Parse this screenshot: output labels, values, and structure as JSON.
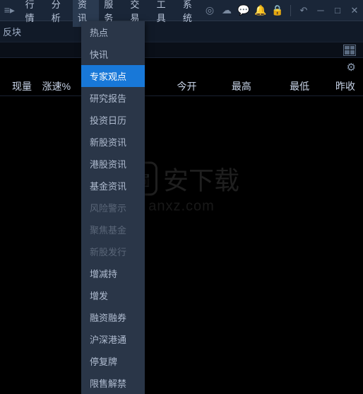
{
  "menubar": {
    "items": [
      "行情",
      "分析",
      "资讯",
      "服务",
      "交易",
      "工具",
      "系统"
    ],
    "activeIndex": 2
  },
  "subbar": {
    "label": "反块"
  },
  "columns": [
    "现量",
    "涨速%",
    "今开",
    "最高",
    "最低",
    "昨收"
  ],
  "dropdown": {
    "items": [
      {
        "label": "热点",
        "disabled": false
      },
      {
        "label": "快讯",
        "disabled": false
      },
      {
        "label": "专家观点",
        "disabled": false,
        "highlight": true
      },
      {
        "label": "研究报告",
        "disabled": false
      },
      {
        "label": "投资日历",
        "disabled": false
      },
      {
        "label": "新股资讯",
        "disabled": false
      },
      {
        "label": "港股资讯",
        "disabled": false
      },
      {
        "label": "基金资讯",
        "disabled": false
      },
      {
        "label": "风险警示",
        "disabled": true
      },
      {
        "label": "聚焦基金",
        "disabled": true
      },
      {
        "label": "新股发行",
        "disabled": true
      },
      {
        "label": "增减持",
        "disabled": false
      },
      {
        "label": "增发",
        "disabled": false
      },
      {
        "label": "融资融券",
        "disabled": false
      },
      {
        "label": "沪深港通",
        "disabled": false
      },
      {
        "label": "停复牌",
        "disabled": false
      },
      {
        "label": "限售解禁",
        "disabled": false
      }
    ]
  },
  "watermark": {
    "title": "安下载",
    "sub": "anxz.com"
  }
}
